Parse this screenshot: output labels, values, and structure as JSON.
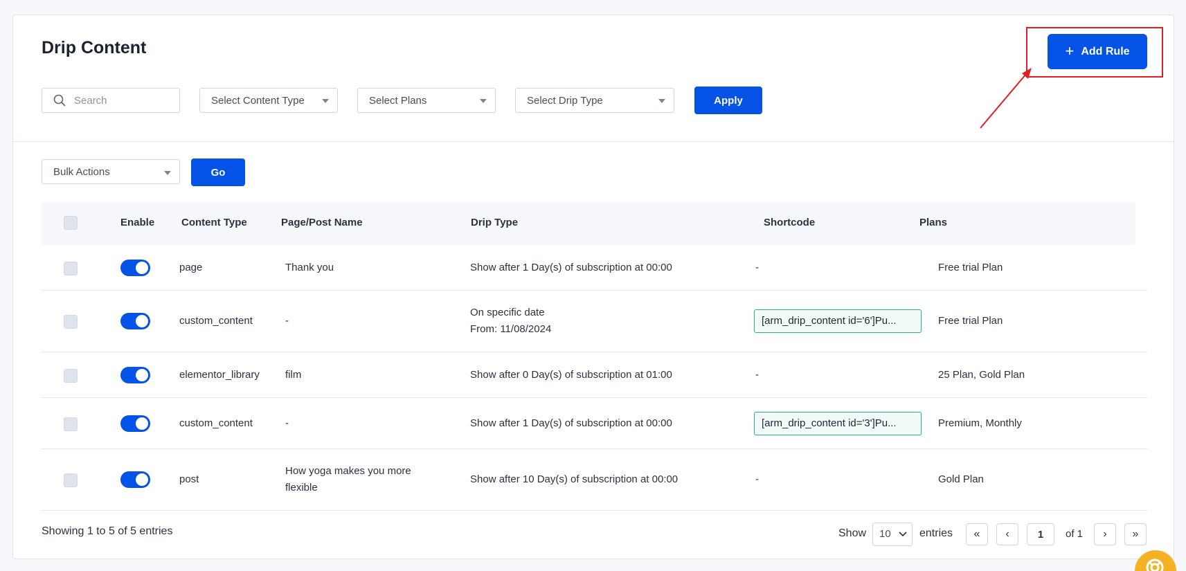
{
  "page": {
    "title": "Drip Content",
    "add_rule_label": "Add Rule"
  },
  "filters": {
    "search_placeholder": "Search",
    "content_type": "Select Content Type",
    "plans": "Select Plans",
    "drip_type": "Select Drip Type",
    "apply_label": "Apply"
  },
  "bulk": {
    "label": "Bulk Actions",
    "go_label": "Go"
  },
  "table": {
    "headers": {
      "enable": "Enable",
      "content_type": "Content Type",
      "page_post_name": "Page/Post Name",
      "drip_type": "Drip Type",
      "shortcode": "Shortcode",
      "plans": "Plans"
    },
    "rows": [
      {
        "enabled": true,
        "content_type": "page",
        "name": "Thank you",
        "name_line2": "",
        "drip_line1": "Show after 1 Day(s) of subscription at 00:00",
        "drip_line2": "",
        "shortcode": "-",
        "plans": "Free trial Plan"
      },
      {
        "enabled": true,
        "content_type": "custom_content",
        "name": "-",
        "name_line2": "",
        "drip_line1": "On specific date",
        "drip_line2": "From: 11/08/2024",
        "shortcode": "[arm_drip_content id='6']Pu...",
        "plans": "Free trial Plan"
      },
      {
        "enabled": true,
        "content_type": "elementor_library",
        "name": "film",
        "name_line2": "",
        "drip_line1": "Show after 0 Day(s) of subscription at 01:00",
        "drip_line2": "",
        "shortcode": "-",
        "plans": "25 Plan, Gold Plan"
      },
      {
        "enabled": true,
        "content_type": "custom_content",
        "name": "-",
        "name_line2": "",
        "drip_line1": "Show after 1 Day(s) of subscription at 00:00",
        "drip_line2": "",
        "shortcode": "[arm_drip_content id='3']Pu...",
        "plans": "Premium, Monthly"
      },
      {
        "enabled": true,
        "content_type": "post",
        "name": "How yoga makes you more",
        "name_line2": "flexible",
        "drip_line1": "Show after 10 Day(s) of subscription at 00:00",
        "drip_line2": "",
        "shortcode": "-",
        "plans": "Gold Plan"
      }
    ]
  },
  "footer": {
    "showing": "Showing 1 to 5 of 5 entries",
    "show_label": "Show",
    "per_page": "10",
    "entries_label": "entries",
    "first": "«",
    "prev": "‹",
    "current_page": "1",
    "of_pages": "of 1",
    "next": "›",
    "last": "»"
  },
  "colors": {
    "primary": "#0552e7",
    "highlight_border": "#e11d24",
    "shortcode_border": "#1fb594",
    "help_bubble": "#f4b323"
  }
}
